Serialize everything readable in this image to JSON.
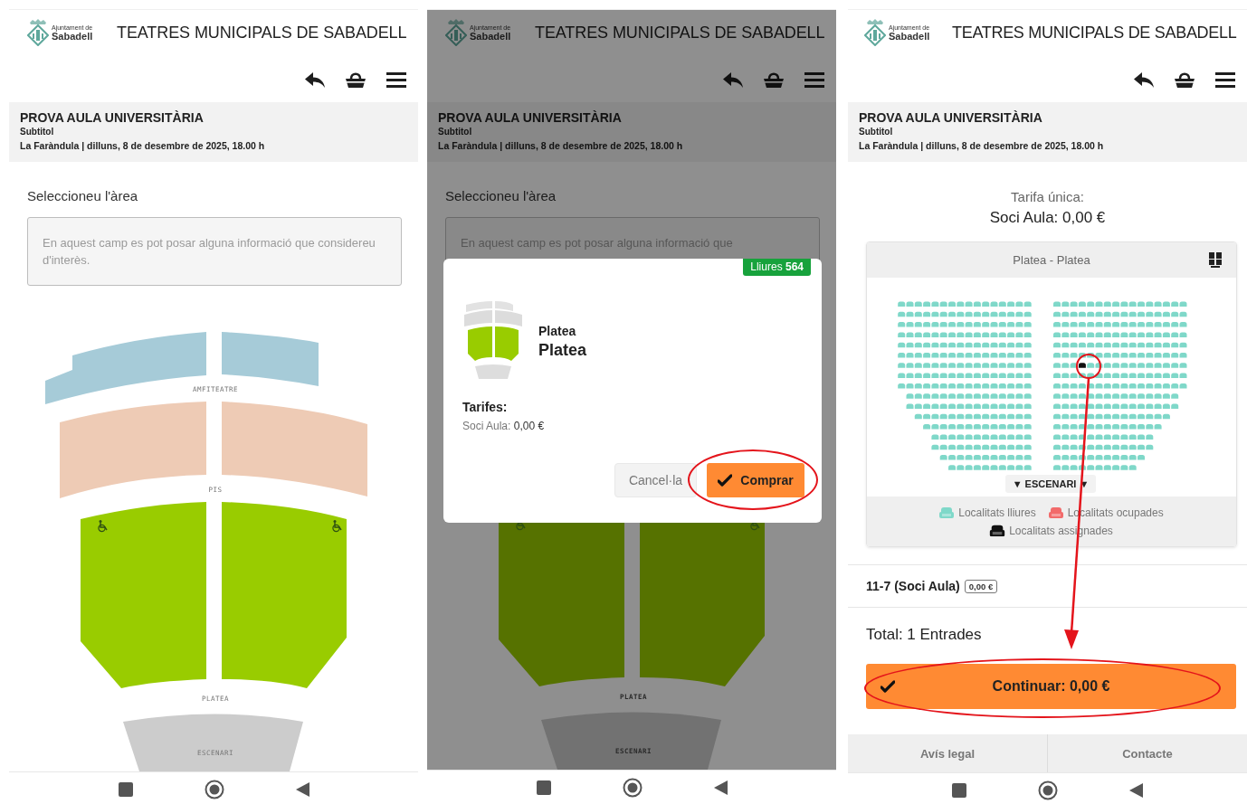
{
  "screens": [
    {
      "kind": "area_map",
      "header": {
        "logo_line1": "Ajuntament de",
        "logo_line2": "Sabadell",
        "title": "TEATRES MUNICIPALS DE SABADELL"
      },
      "event": {
        "title": "PROVA AULA UNIVERSITÀRIA",
        "subtitle": "Subtitol",
        "details": "La Faràndula | dilluns, 8 de desembre de 2025, 18.00 h"
      },
      "area_prompt": "Seleccioneu l'àrea",
      "info_note": "En aquest camp es pot posar alguna informació que considereu d'interès.",
      "venue_map": {
        "sections": [
          {
            "kind": "amfiteatre",
            "label": "AMFITEATRE",
            "color": "#a6cbd8",
            "accessible": false
          },
          {
            "kind": "pis",
            "label": "PIS",
            "color": "#eecbb5",
            "accessible": false
          },
          {
            "kind": "platea",
            "label": "PLATEA",
            "color": "#99cc00",
            "accessible": true
          },
          {
            "kind": "escenari",
            "label": "ESCENARI",
            "color": "#cccccc",
            "accessible": false
          }
        ]
      }
    },
    {
      "kind": "area_dialog",
      "header": {
        "logo_line1": "Ajuntament de",
        "logo_line2": "Sabadell",
        "title": "TEATRES MUNICIPALS DE SABADELL"
      },
      "event": {
        "title": "PROVA AULA UNIVERSITÀRIA",
        "subtitle": "Subtitol",
        "details": "La Faràndula | dilluns, 8 de desembre de 2025, 18.00 h"
      },
      "area_prompt": "Seleccioneu l'àrea",
      "info_note": "En aquest camp es pot posar alguna informació que",
      "venue_map": {
        "sections": [
          {
            "kind": "platea",
            "label": "PLATEA",
            "color": "#567200",
            "accessible": true
          },
          {
            "kind": "escenari",
            "label": "ESCENARI",
            "color": "#727272",
            "accessible": false
          }
        ]
      },
      "dialog": {
        "badge": "Lliures **564**",
        "title": "Platea",
        "subtitle": "Platea",
        "rates_label": "Tarifes:",
        "rate": "Soci Aula: **0,00 €**",
        "cancel_button": "Cancel·la",
        "buy_button": "Comprar"
      },
      "annotations": [
        {
          "kind": "button_ring"
        }
      ]
    },
    {
      "kind": "seat_selection",
      "header": {
        "logo_line1": "Ajuntament de",
        "logo_line2": "Sabadell",
        "title": "TEATRES MUNICIPALS DE SABADELL"
      },
      "event": {
        "title": "PROVA AULA UNIVERSITÀRIA",
        "subtitle": "Subtitol",
        "details": "La Faràndula | dilluns, 8 de desembre de 2025, 18.00 h"
      },
      "tariff": {
        "label": "Tarifa única:",
        "price": "Soci Aula: 0,00 €"
      },
      "seat_card": {
        "title": "Platea - Platea",
        "stage_label": "▼ ESCENARI ▼",
        "legend": [
          {
            "kind": "free",
            "label": "Localitats lliures",
            "color": "#7fd8c9"
          },
          {
            "kind": "occupied",
            "label": "Localitats ocupades",
            "color": "#f26b6b"
          },
          {
            "kind": "assigned",
            "label": "Localitats assignades",
            "color": "#111111"
          }
        ]
      },
      "ticket": {
        "seat": "11-7 (Soci Aula)",
        "price": "0,00 €"
      },
      "total": "Total: 1 Entrades",
      "continue_button": "Continuar: 0,00 €",
      "footer_links": [
        "Avís legal",
        "Contacte"
      ],
      "annotations": [
        {
          "kind": "seat_ring"
        },
        {
          "kind": "arrow"
        },
        {
          "kind": "button_ring"
        }
      ]
    }
  ]
}
